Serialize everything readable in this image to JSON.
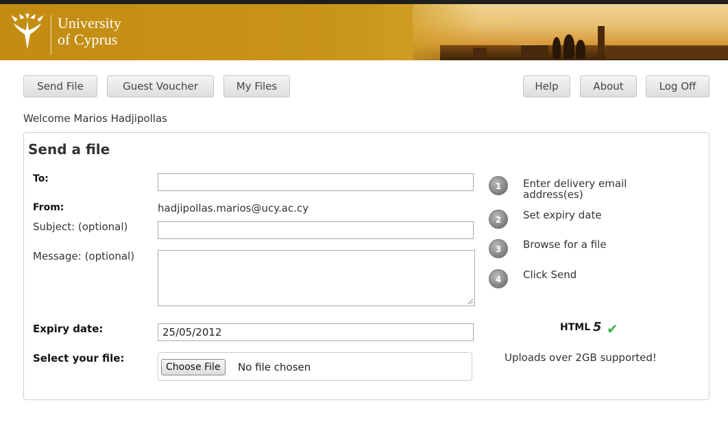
{
  "header": {
    "logo_line1": "University",
    "logo_line2": "of Cyprus",
    "accent_color": "#c99518"
  },
  "nav": {
    "send_file": "Send File",
    "guest_voucher": "Guest Voucher",
    "my_files": "My Files",
    "help": "Help",
    "about": "About",
    "log_off": "Log Off"
  },
  "welcome": "Welcome Marios Hadjipollas",
  "form": {
    "title": "Send a file",
    "to_label": "To:",
    "to_value": "",
    "from_label": "From:",
    "from_value": "hadjipollas.marios@ucy.ac.cy",
    "subject_label": "Subject: (optional)",
    "subject_value": "",
    "message_label": "Message: (optional)",
    "message_value": "",
    "expiry_label": "Expiry date:",
    "expiry_value": "25/05/2012",
    "file_label": "Select your file:",
    "choose_file": "Choose File",
    "no_file": "No file chosen"
  },
  "steps": [
    {
      "number": "1",
      "text": "Enter delivery email address(es)"
    },
    {
      "number": "2",
      "text": "Set expiry date"
    },
    {
      "number": "3",
      "text": "Browse for a file"
    },
    {
      "number": "4",
      "text": "Click Send"
    }
  ],
  "support": {
    "html5_label": "HTML",
    "html5_number": "5",
    "check_icon": "check-icon",
    "check_color": "#3fae49",
    "uploads_note": "Uploads over 2GB supported!"
  }
}
